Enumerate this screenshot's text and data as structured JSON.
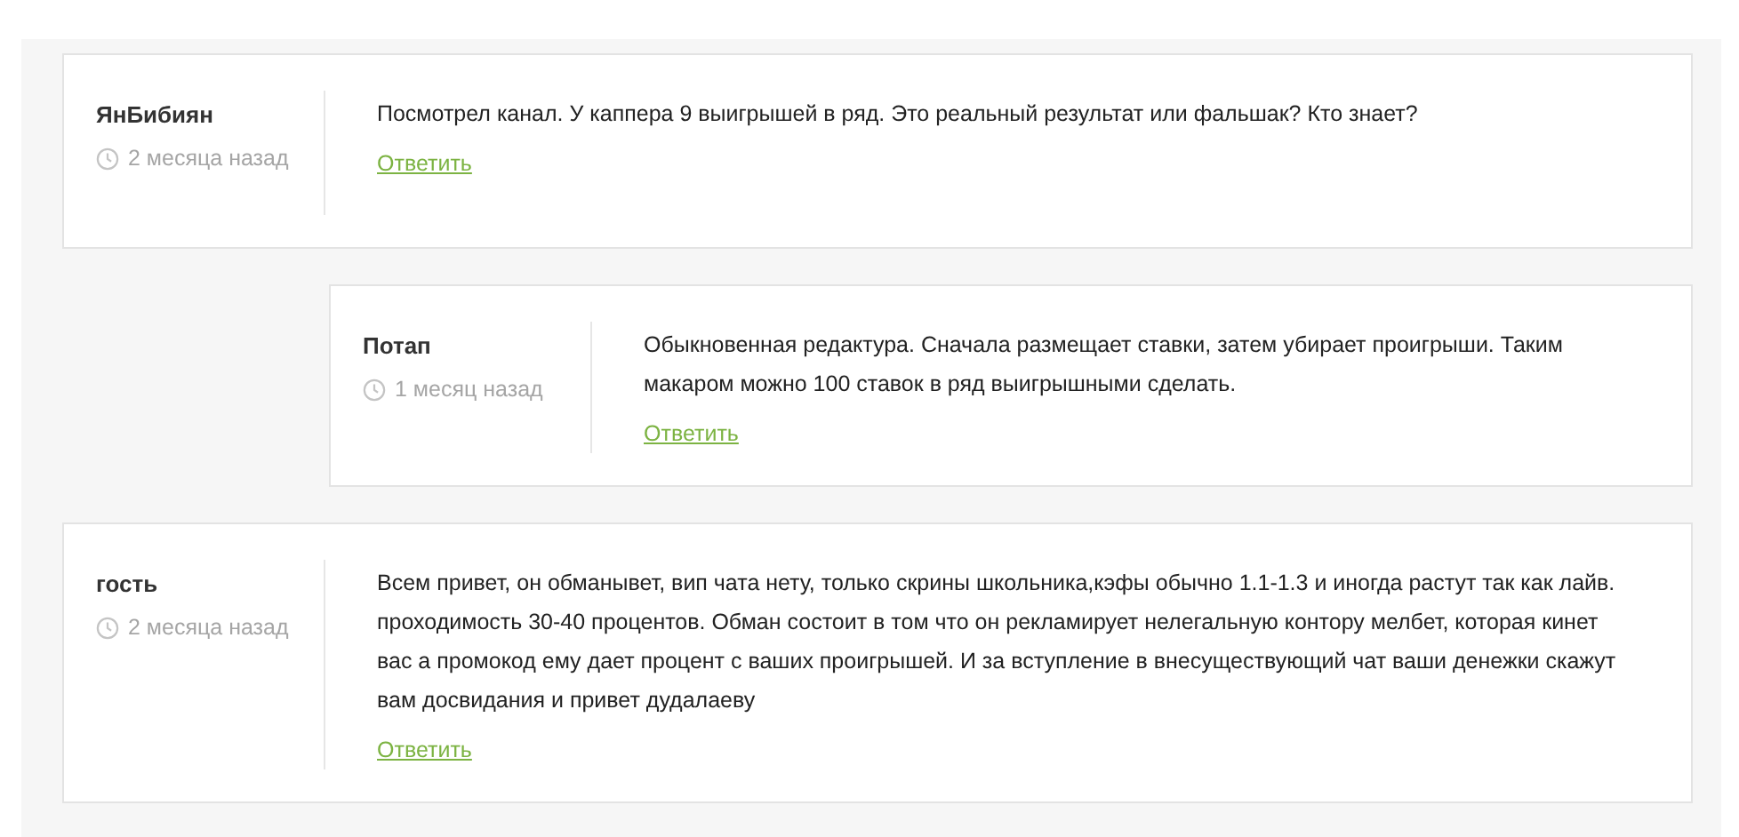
{
  "comments": [
    {
      "author": "ЯнБибиян",
      "time": "2 месяца назад",
      "text": "Посмотрел канал. У каппера 9 выигрышей в ряд. Это реальный результат или фальшак? Кто знает?",
      "reply_label": "Ответить",
      "children": [
        {
          "author": "Потап",
          "time": "1 месяц назад",
          "text": "Обыкновенная редактура. Сначала размещает ставки, затем убирает проигрыши. Таким макаром можно 100 ставок в ряд выигрышными сделать.",
          "reply_label": "Ответить"
        }
      ]
    },
    {
      "author": "гость",
      "time": "2 месяца назад",
      "text": "Всем привет, он обманывет, вип чата нету, только скрины школьника,кэфы обычно 1.1-1.3 и иногда растут так как лайв. проходимость 30-40 процентов. Обман состоит в том что он рекламирует нелегальную контору мелбет, которая кинет вас а промокод ему дает процент с ваших проигрышей. И за вступление в внесуществующий чат ваши денежки скажут вам досвидания и привет дудалаеву",
      "reply_label": "Ответить"
    }
  ]
}
